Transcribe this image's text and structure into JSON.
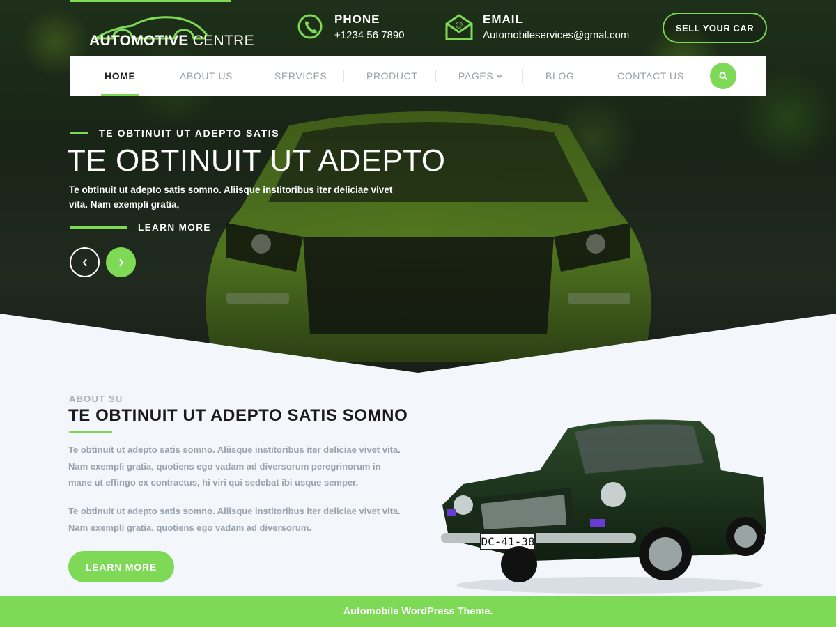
{
  "colors": {
    "accent": "#7ed957",
    "dark_text": "#1a1a1a",
    "muted_text": "#9aa2ac",
    "nav_inactive": "#9aa0a6",
    "page_bg": "#f3f6fb",
    "white": "#ffffff"
  },
  "header": {
    "logo": {
      "bold": "AUTOMOTIVE",
      "light": "CENTRE"
    },
    "phone": {
      "label": "PHONE",
      "value": "+1234 56 7890",
      "icon": "phone-icon"
    },
    "email": {
      "label": "EMAIL",
      "value": "Automobileservices@gmal.com",
      "icon": "mail-icon"
    },
    "sell_button": "SELL YOUR CAR"
  },
  "nav": {
    "items": [
      {
        "label": "HOME",
        "active": true
      },
      {
        "label": "ABOUT US",
        "active": false
      },
      {
        "label": "SERVICES",
        "active": false
      },
      {
        "label": "PRODUCT",
        "active": false
      },
      {
        "label": "PAGES",
        "active": false,
        "has_dropdown": true
      },
      {
        "label": "BLOG",
        "active": false
      },
      {
        "label": "CONTACT US",
        "active": false
      }
    ],
    "search_icon": "search-icon"
  },
  "hero": {
    "kicker": "TE OBTINUIT UT ADEPTO SATIS",
    "title": "TE OBTINUIT UT ADEPTO",
    "description": "Te obtinuit ut adepto satis somno. Aliisque institoribus iter deliciae vivet vita. Nam exempli gratia,",
    "learn_more": "LEARN MORE",
    "prev_icon": "chevron-left-icon",
    "next_icon": "chevron-right-icon"
  },
  "about": {
    "kicker": "ABOUT SU",
    "title": "TE OBTINUIT UT ADEPTO SATIS SOMNO",
    "paragraph1": "Te obtinuit ut adepto satis somno. Aliisque institoribus iter deliciae vivet vita. Nam exempli gratia, quotiens ego vadam ad diversorum peregrinorum in mane ut effingo ex contractus, hi viri qui sedebat ibi usque semper.",
    "paragraph2": "Te obtinuit ut adepto satis somno. Aliisque institoribus iter deliciae vivet vita. Nam exempli gratia, quotiens ego vadam ad diversorum.",
    "button": "LEARN MORE",
    "plate": "DC-41-38"
  },
  "footer": {
    "text": "Automobile WordPress Theme."
  }
}
